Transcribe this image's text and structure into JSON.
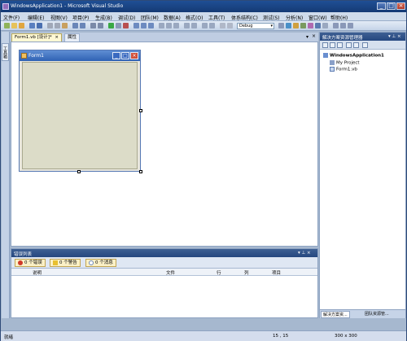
{
  "window": {
    "title": "WindowsApplication1 - Microsoft Visual Studio",
    "min": "_",
    "max": "□",
    "close": "×"
  },
  "menu": [
    "文件(F)",
    "编辑(E)",
    "视图(V)",
    "项目(P)",
    "生成(B)",
    "调试(D)",
    "团队(M)",
    "数据(A)",
    "格式(O)",
    "工具(T)",
    "体系结构(C)",
    "测试(S)",
    "分析(N)",
    "窗口(W)",
    "帮助(H)"
  ],
  "toolbar": {
    "config_value": "Debug",
    "config_arrow": "▾"
  },
  "toolbox": {
    "label": "工具箱"
  },
  "doc_tabs": {
    "designer": "Form1.vb [设计]*",
    "designer_close": "×",
    "properties": "属性",
    "menu_arrow": "▾",
    "close": "×"
  },
  "form": {
    "title": "Form1",
    "min": "_",
    "max": "□",
    "close": "×"
  },
  "solution_explorer": {
    "title": "解决方案资源管理器",
    "pin": "▾ ⊥ ×",
    "solution": "WindowsApplication1",
    "items": [
      "My Project",
      "Form1.vb"
    ],
    "tab_solution": "解决方案资...",
    "tab_team": "团队资源管..."
  },
  "error_list": {
    "title": "错误列表",
    "pin": "▾ ⊥ ×",
    "errors": "0 个错误",
    "warnings": "0 个警告",
    "messages": "0 个消息",
    "columns": [
      "说明",
      "文件",
      "行",
      "列",
      "项目"
    ]
  },
  "status": {
    "left": "就绪",
    "position": "15 , 15",
    "size": "300 x 300"
  },
  "colors": {
    "accent": "#25477f",
    "form_title": "#2f62b4"
  }
}
